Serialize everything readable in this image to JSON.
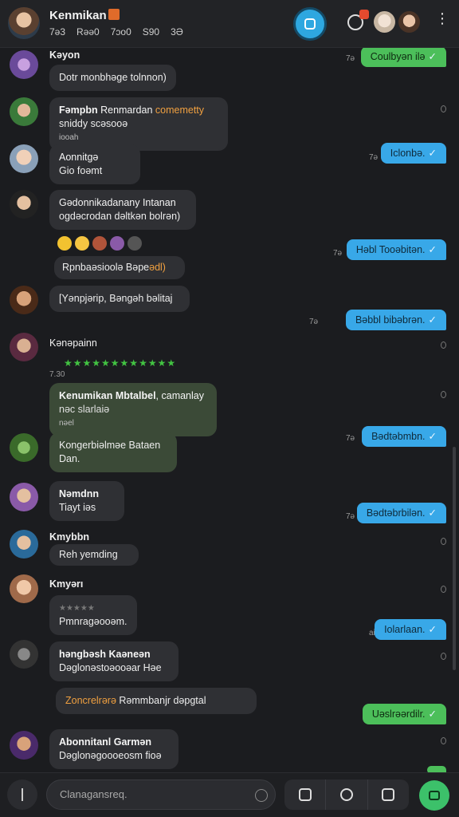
{
  "header": {
    "title": "Kenmikan",
    "stats": [
      "7ə3",
      "Rəə0",
      "7ɔo0",
      "S90",
      "3Ə"
    ]
  },
  "messages": [
    {
      "name": "Kəyon",
      "text": "Dotr monbhəge tolnnon)"
    },
    {
      "name": "Fəmpbn",
      "name_extra": "Renmardan",
      "name_tag": "comemetty",
      "text": "sniddy scəsooə",
      "meta": "iooah"
    },
    {
      "name": "Aonnitgə",
      "text": "Gio foəmt"
    },
    {
      "name": "Gədonnikadanany Intanan",
      "text": "ogdəcrodan dəltkən bolrən)"
    },
    {
      "text": "Rpnbaəsioolə Bəpe",
      "tag": "ədl)"
    },
    {
      "text": "[Yənpjərip, Bəngəh bəlitaj"
    },
    {
      "name": "Kənəpainn"
    },
    {
      "time": "7.30"
    },
    {
      "name": "Kenumikan Mbtalbel",
      "name_extra": ", camanlay",
      "text": "nəc slarlaiə",
      "meta": "nəel"
    },
    {
      "name": "Kongerbiəlməe Bataen",
      "text": "Dan."
    },
    {
      "name": "Nəmdnn",
      "text": "Tiayt iəs"
    },
    {
      "name": "Kmybbn",
      "text": "Reh yemding"
    },
    {
      "name": "Kmyərı",
      "text": "Pmnragəooəm."
    },
    {
      "name": "həngbəsh Kaəneən",
      "text": "Dəglonəstoəooəar Həe"
    },
    {
      "text_orange": "Zoncrelrərə",
      "text": "Rəmmbanjr dəpgtal"
    },
    {
      "name": "Abonnitanl Garmən",
      "text": "Dəglonəgoooeosm fioə"
    }
  ],
  "outgoing": [
    {
      "text": "Coulbyən ilə",
      "time": "7ə"
    },
    {
      "text": "Iclonbə.",
      "time": "7ə"
    },
    {
      "text": "Həbl Tooəbitən.",
      "time": "7ə"
    },
    {
      "text": "Bəbbl bibəbrən.",
      "time": "7ə"
    },
    {
      "text": "Bədtəbmbn.",
      "time": "7ə"
    },
    {
      "text": "Bədtəbrbilən.",
      "time": "7ə"
    },
    {
      "text": "Iolarlaan.",
      "time": "ai"
    },
    {
      "text": "Uəslrəərdilr.",
      "time": ""
    }
  ],
  "input": {
    "placeholder": "Clanagansreq."
  },
  "colors": {
    "accent_blue": "#38a8e8",
    "accent_green": "#4cbf5a",
    "background": "#1b1c1f"
  }
}
